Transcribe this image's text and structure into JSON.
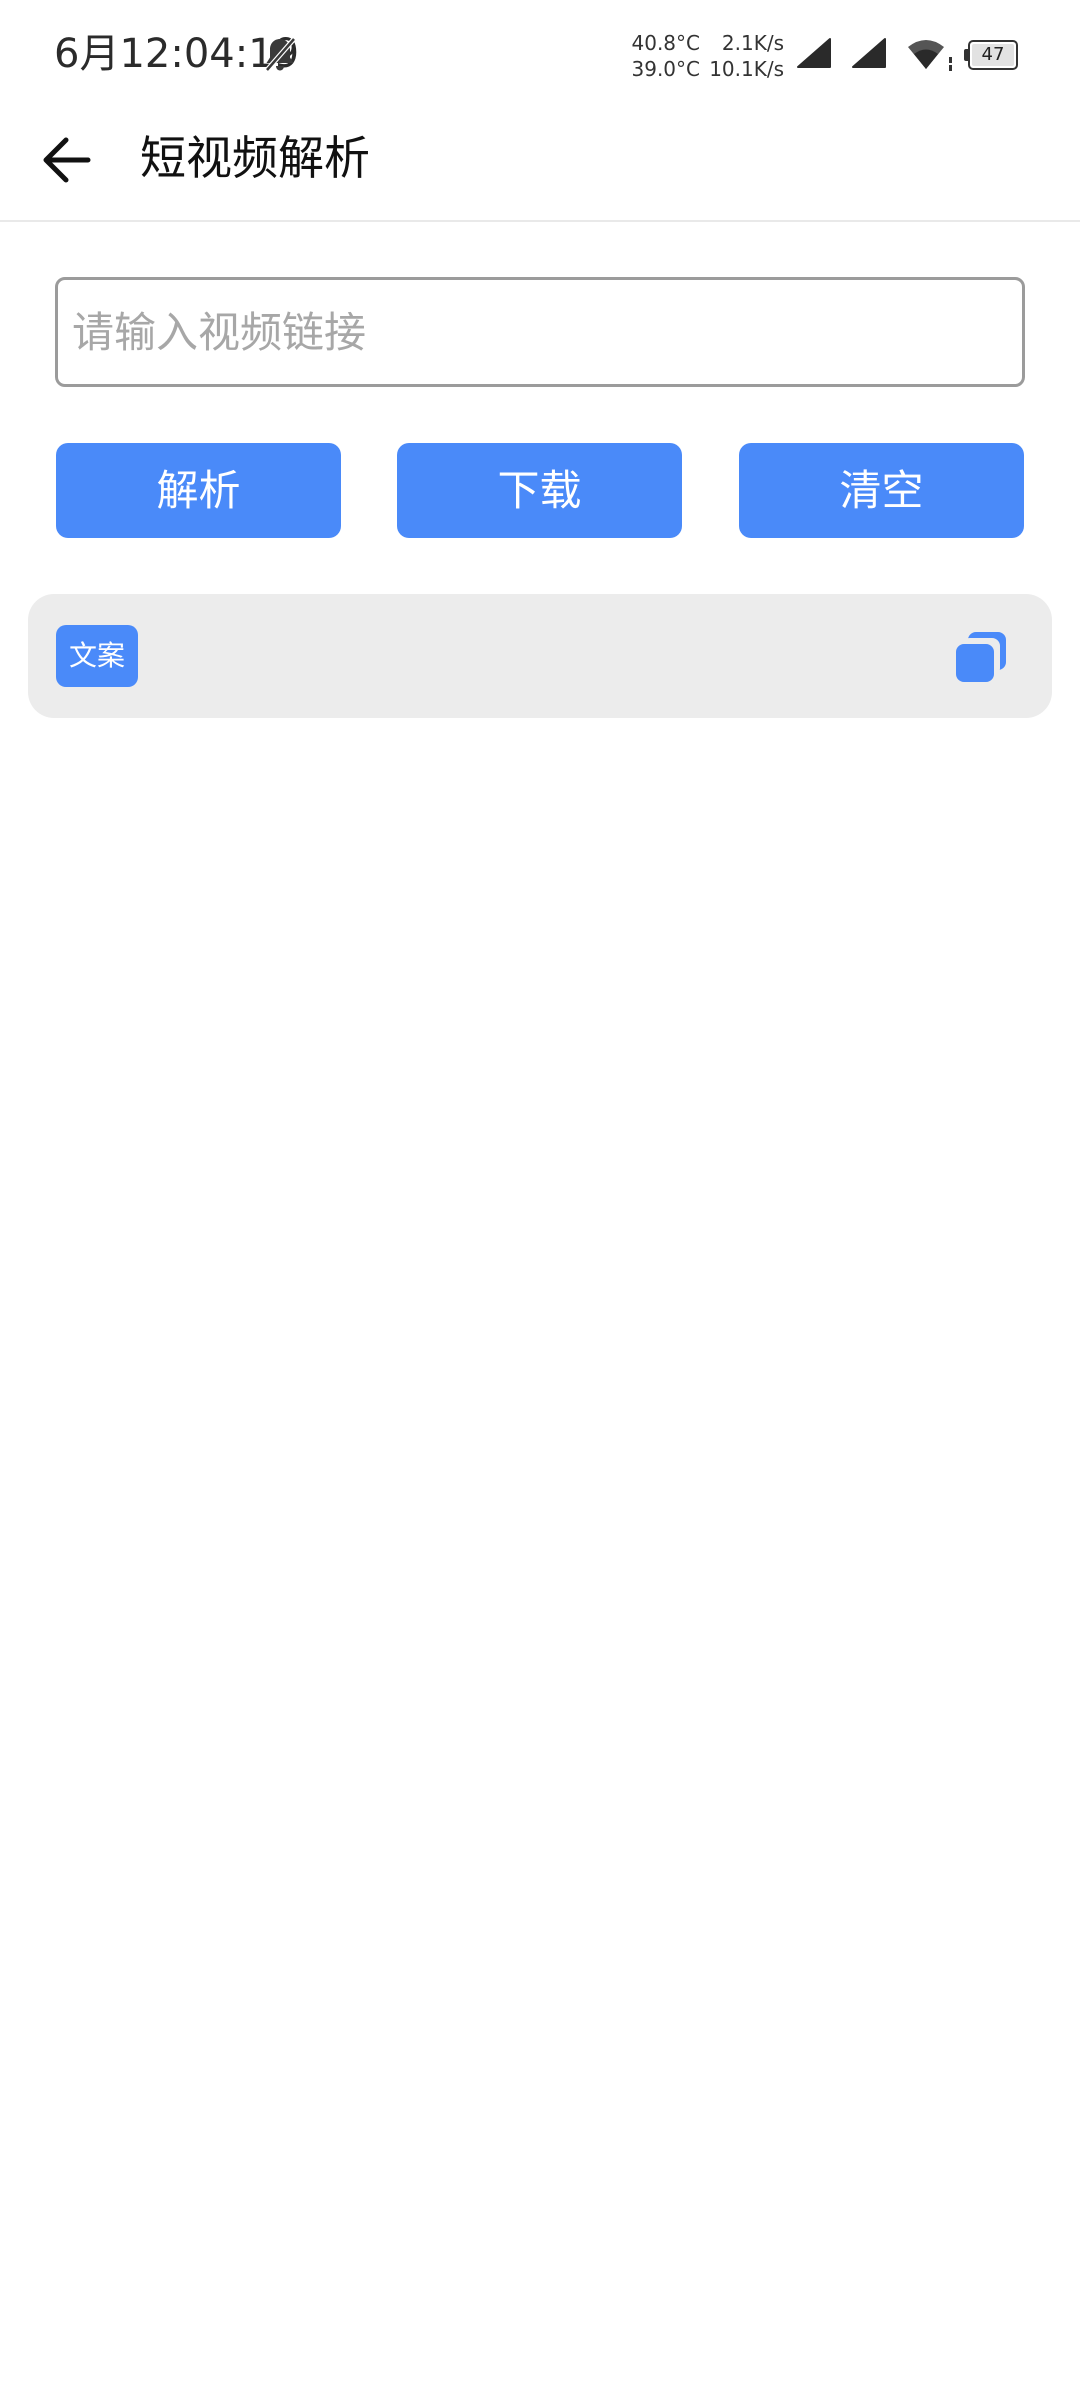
{
  "status_bar": {
    "time": "6月12:04:19",
    "temp_top": "40.8°C",
    "temp_bottom": "39.0°C",
    "net_top": "2.1K/s",
    "net_bottom": "10.1K/s",
    "battery": "47",
    "icons": [
      "bell-off-icon",
      "signal-icon",
      "signal-icon",
      "wifi-icon",
      "battery-icon"
    ]
  },
  "app_bar": {
    "back_icon": "arrow-left-icon",
    "title": "短视频解析"
  },
  "form": {
    "placeholder": "请输入视频链接",
    "value": ""
  },
  "buttons": {
    "parse": "解析",
    "download": "下载",
    "clear": "清空"
  },
  "copy_panel": {
    "tag": "文案",
    "copy_icon": "copy-icon"
  },
  "colors": {
    "accent": "#4a8af9",
    "panel_bg": "#ececec",
    "input_border": "#9b9b9b",
    "placeholder": "#a7a7a7"
  }
}
